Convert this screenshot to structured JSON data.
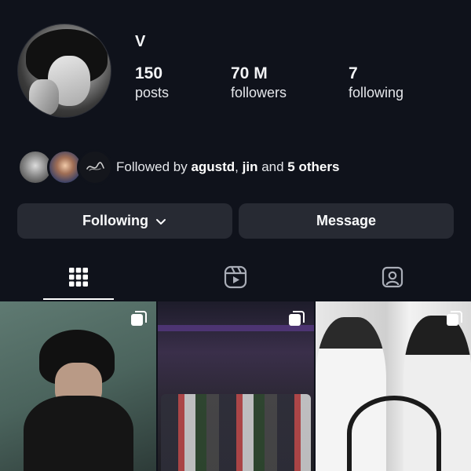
{
  "profile": {
    "username": "V",
    "stats": {
      "posts_count": "150",
      "posts_label": "posts",
      "followers_count": "70 M",
      "followers_label": "followers",
      "following_count": "7",
      "following_label": "following"
    },
    "followed_by": {
      "prefix": "Followed by ",
      "user1": "agustd",
      "separator": ", ",
      "user2": "jin",
      "conjunction": " and ",
      "others": "5 others"
    }
  },
  "actions": {
    "following_label": "Following",
    "message_label": "Message"
  },
  "tabs": [
    {
      "name": "posts-grid",
      "icon": "grid-icon",
      "active": true
    },
    {
      "name": "reels",
      "icon": "reels-icon",
      "active": false
    },
    {
      "name": "tagged",
      "icon": "tagged-icon",
      "active": false
    }
  ],
  "grid": [
    {
      "icon": "multiple-posts-icon"
    },
    {
      "icon": "multiple-posts-icon"
    },
    {
      "icon": "multiple-posts-icon"
    }
  ],
  "colors": {
    "background": "#0f121b",
    "button_bg": "#272a33",
    "text": "#f3f4f6",
    "tab_indicator": "#ffffff"
  }
}
